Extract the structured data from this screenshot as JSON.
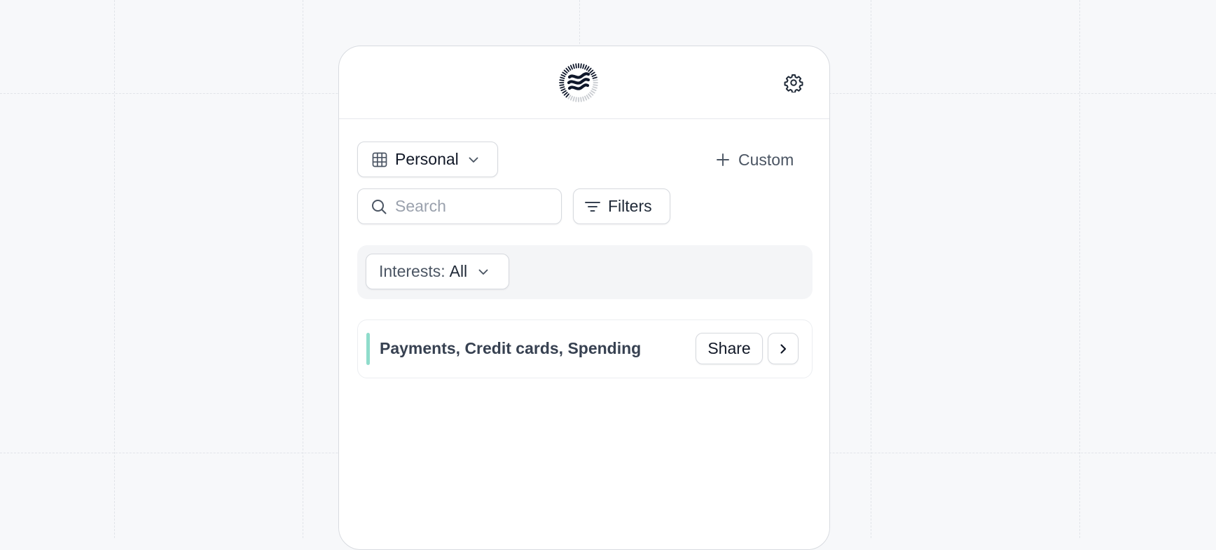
{
  "header": {
    "logo_icon": "wave-seal-logo",
    "settings_icon": "gear-icon"
  },
  "toolbar": {
    "view_selector": {
      "icon": "grid-icon",
      "label": "Personal",
      "chevron_icon": "chevron-down-icon"
    },
    "custom_button": {
      "icon": "plus-icon",
      "label": "Custom"
    },
    "search": {
      "icon": "search-icon",
      "placeholder": "Search",
      "value": ""
    },
    "filters_button": {
      "icon": "filter-lines-icon",
      "label": "Filters"
    }
  },
  "filter_bar": {
    "interests_dropdown": {
      "prefix": "Interests:",
      "value": "All",
      "chevron_icon": "chevron-down-icon"
    }
  },
  "items": [
    {
      "title": "Payments, Credit cards, Spending",
      "accent_color": "#8fdccb",
      "share_label": "Share",
      "next_icon": "chevron-right-icon"
    }
  ],
  "colors": {
    "background": "#f7f8fa",
    "panel": "#ffffff",
    "accent": "#8fdccb",
    "text_primary": "#111827",
    "text_secondary": "#4b5563"
  }
}
